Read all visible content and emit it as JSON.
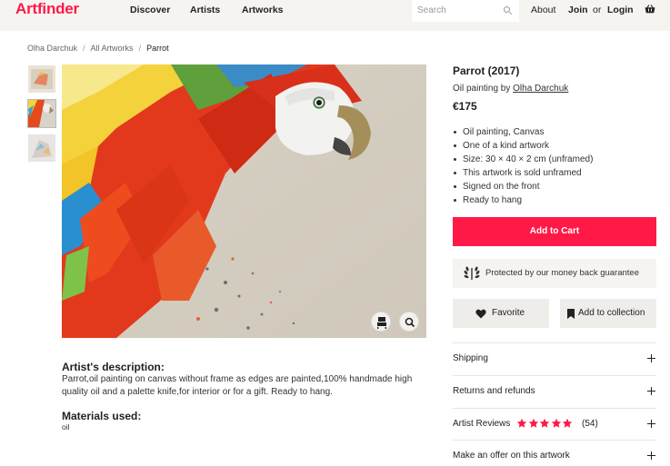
{
  "header": {
    "logo": "Artfinder",
    "nav": [
      "Discover",
      "Artists",
      "Artworks"
    ],
    "search_placeholder": "Search",
    "about": "About",
    "join": "Join",
    "or": "or",
    "login": "Login",
    "cart_icon": "basket-icon"
  },
  "breadcrumb": [
    "Olha Darchuk",
    "All Artworks",
    "Parrot"
  ],
  "breadcrumb_separator": "/",
  "gallery": {
    "thumbnails": 3,
    "selected_thumbnail": 2,
    "buttons": [
      "view-in-room-icon",
      "zoom-icon"
    ]
  },
  "description": {
    "title": "Artist's description:",
    "text": "Parrot,oil painting on canvas without frame as edges are painted,100% handmade high quality oil and a palette knife,for interior or for a gift. Ready to hang.",
    "materials_title": "Materials used:",
    "materials": "oil"
  },
  "product": {
    "title": "Parrot (2017)",
    "subtitle_prefix": "Oil painting by ",
    "artist": "Olha Darchuk",
    "price": "€175",
    "features": [
      "Oil painting, Canvas",
      "One of a kind artwork",
      "Size: 30 × 40 × 2 cm (unframed)",
      "This artwork is sold unframed",
      "Signed on the front",
      "Ready to hang"
    ],
    "add_to_cart": "Add to Cart",
    "guarantee": "Protected by our money back guarantee",
    "favorite": "Favorite",
    "add_collection": "Add to collection"
  },
  "accordion": [
    {
      "label": "Shipping"
    },
    {
      "label": "Returns and refunds"
    },
    {
      "label": "Artist Reviews",
      "rating": 5,
      "count": "(54)"
    },
    {
      "label": "Make an offer on this artwork"
    }
  ],
  "colors": {
    "brand": "#ff1947",
    "nav_bg": "#f5f4f1",
    "star": "#ff1947"
  }
}
